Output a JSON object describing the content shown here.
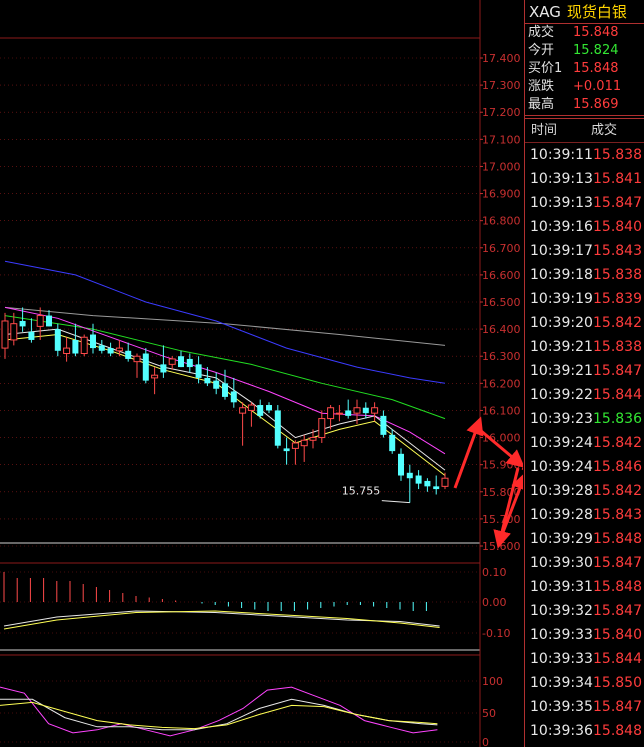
{
  "symbol": {
    "code": "XAG",
    "name": "现货白银"
  },
  "quote": [
    {
      "label": "成交",
      "value": "15.848",
      "color": "#ff3c3c"
    },
    {
      "label": "今开",
      "value": "15.824",
      "color": "#33e633"
    },
    {
      "label": "买价1",
      "value": "15.848",
      "color": "#ff3c3c"
    },
    {
      "label": "涨跌",
      "value": "+0.011",
      "color": "#ff3c3c"
    },
    {
      "label": "最高",
      "value": "15.869",
      "color": "#ff3c3c"
    }
  ],
  "ticks_header": {
    "time": "时间",
    "price": "成交"
  },
  "ticks": [
    {
      "time": "10:39:11",
      "price": "15.838",
      "dir": "up"
    },
    {
      "time": "10:39:13",
      "price": "15.841",
      "dir": "up"
    },
    {
      "time": "10:39:13",
      "price": "15.847",
      "dir": "up"
    },
    {
      "time": "10:39:16",
      "price": "15.840",
      "dir": "up"
    },
    {
      "time": "10:39:17",
      "price": "15.843",
      "dir": "up"
    },
    {
      "time": "10:39:18",
      "price": "15.838",
      "dir": "up"
    },
    {
      "time": "10:39:19",
      "price": "15.839",
      "dir": "up"
    },
    {
      "time": "10:39:20",
      "price": "15.842",
      "dir": "up"
    },
    {
      "time": "10:39:21",
      "price": "15.838",
      "dir": "up"
    },
    {
      "time": "10:39:21",
      "price": "15.847",
      "dir": "up"
    },
    {
      "time": "10:39:22",
      "price": "15.844",
      "dir": "up"
    },
    {
      "time": "10:39:23",
      "price": "15.836",
      "dir": "down"
    },
    {
      "time": "10:39:24",
      "price": "15.842",
      "dir": "up"
    },
    {
      "time": "10:39:24",
      "price": "15.846",
      "dir": "up"
    },
    {
      "time": "10:39:28",
      "price": "15.842",
      "dir": "up"
    },
    {
      "time": "10:39:28",
      "price": "15.843",
      "dir": "up"
    },
    {
      "time": "10:39:29",
      "price": "15.848",
      "dir": "up"
    },
    {
      "time": "10:39:30",
      "price": "15.847",
      "dir": "up"
    },
    {
      "time": "10:39:31",
      "price": "15.848",
      "dir": "up"
    },
    {
      "time": "10:39:32",
      "price": "15.847",
      "dir": "up"
    },
    {
      "time": "10:39:33",
      "price": "15.840",
      "dir": "up"
    },
    {
      "time": "10:39:33",
      "price": "15.844",
      "dir": "up"
    },
    {
      "time": "10:39:34",
      "price": "15.850",
      "dir": "up"
    },
    {
      "time": "10:39:35",
      "price": "15.847",
      "dir": "up"
    },
    {
      "time": "10:39:36",
      "price": "15.848",
      "dir": "up"
    }
  ],
  "colors": {
    "up": "#ff3c3c",
    "down": "#33e633",
    "candle_up": "#ff4a4a",
    "candle_down": "#54ffff",
    "grid": "#8b1a1a",
    "axis_text": "#c83030",
    "ma_white": "#e8e8e8",
    "ma_yellow": "#ffff55",
    "ma_magenta": "#ff44ff",
    "ma_green": "#22dd22",
    "ma_blue": "#3b3bff",
    "ma_gray": "#9a9a9a",
    "arrow": "#ff2a2a"
  },
  "chart_data": [
    {
      "type": "candlestick",
      "y_ticks": [
        "17.400",
        "17.300",
        "17.200",
        "17.100",
        "17.000",
        "16.900",
        "16.800",
        "16.700",
        "16.600",
        "16.500",
        "16.400",
        "16.300",
        "16.200",
        "16.100",
        "16.000",
        "15.900",
        "15.800",
        "15.700",
        "15.600"
      ],
      "ylim": [
        15.6,
        17.4
      ],
      "annotation": "15.755",
      "candles": [
        {
          "o": 16.33,
          "h": 16.46,
          "l": 16.29,
          "c": 16.43
        },
        {
          "o": 16.36,
          "h": 16.46,
          "l": 16.34,
          "c": 16.42
        },
        {
          "o": 16.43,
          "h": 16.48,
          "l": 16.39,
          "c": 16.41
        },
        {
          "o": 16.39,
          "h": 16.44,
          "l": 16.35,
          "c": 16.36
        },
        {
          "o": 16.41,
          "h": 16.48,
          "l": 16.36,
          "c": 16.45
        },
        {
          "o": 16.45,
          "h": 16.47,
          "l": 16.41,
          "c": 16.41
        },
        {
          "o": 16.4,
          "h": 16.42,
          "l": 16.3,
          "c": 16.32
        },
        {
          "o": 16.31,
          "h": 16.37,
          "l": 16.28,
          "c": 16.33
        },
        {
          "o": 16.36,
          "h": 16.42,
          "l": 16.3,
          "c": 16.31
        },
        {
          "o": 16.31,
          "h": 16.38,
          "l": 16.3,
          "c": 16.37
        },
        {
          "o": 16.38,
          "h": 16.42,
          "l": 16.31,
          "c": 16.33
        },
        {
          "o": 16.34,
          "h": 16.36,
          "l": 16.31,
          "c": 16.32
        },
        {
          "o": 16.33,
          "h": 16.35,
          "l": 16.3,
          "c": 16.31
        },
        {
          "o": 16.32,
          "h": 16.36,
          "l": 16.3,
          "c": 16.33
        },
        {
          "o": 16.32,
          "h": 16.35,
          "l": 16.28,
          "c": 16.29
        },
        {
          "o": 16.28,
          "h": 16.31,
          "l": 16.22,
          "c": 16.3
        },
        {
          "o": 16.31,
          "h": 16.33,
          "l": 16.2,
          "c": 16.21
        },
        {
          "o": 16.22,
          "h": 16.26,
          "l": 16.16,
          "c": 16.23
        },
        {
          "o": 16.27,
          "h": 16.34,
          "l": 16.22,
          "c": 16.24
        },
        {
          "o": 16.27,
          "h": 16.3,
          "l": 16.25,
          "c": 16.29
        },
        {
          "o": 16.3,
          "h": 16.32,
          "l": 16.26,
          "c": 16.26
        },
        {
          "o": 16.29,
          "h": 16.31,
          "l": 16.24,
          "c": 16.26
        },
        {
          "o": 16.27,
          "h": 16.3,
          "l": 16.2,
          "c": 16.22
        },
        {
          "o": 16.22,
          "h": 16.26,
          "l": 16.19,
          "c": 16.2
        },
        {
          "o": 16.21,
          "h": 16.24,
          "l": 16.16,
          "c": 16.18
        },
        {
          "o": 16.2,
          "h": 16.25,
          "l": 16.14,
          "c": 16.15
        },
        {
          "o": 16.17,
          "h": 16.22,
          "l": 16.11,
          "c": 16.13
        },
        {
          "o": 16.09,
          "h": 16.13,
          "l": 15.97,
          "c": 16.11
        },
        {
          "o": 16.1,
          "h": 16.13,
          "l": 16.04,
          "c": 16.12
        },
        {
          "o": 16.12,
          "h": 16.14,
          "l": 16.07,
          "c": 16.08
        },
        {
          "o": 16.12,
          "h": 16.13,
          "l": 16.09,
          "c": 16.1
        },
        {
          "o": 16.1,
          "h": 16.12,
          "l": 15.96,
          "c": 15.97
        },
        {
          "o": 15.96,
          "h": 16.0,
          "l": 15.9,
          "c": 15.95
        },
        {
          "o": 15.96,
          "h": 15.99,
          "l": 15.9,
          "c": 15.98
        },
        {
          "o": 15.97,
          "h": 16.01,
          "l": 15.91,
          "c": 15.99
        },
        {
          "o": 15.99,
          "h": 16.03,
          "l": 15.96,
          "c": 16.0
        },
        {
          "o": 16.0,
          "h": 16.1,
          "l": 15.98,
          "c": 16.07
        },
        {
          "o": 16.07,
          "h": 16.12,
          "l": 16.03,
          "c": 16.11
        },
        {
          "o": 16.09,
          "h": 16.12,
          "l": 16.06,
          "c": 16.09
        },
        {
          "o": 16.1,
          "h": 16.14,
          "l": 16.07,
          "c": 16.08
        },
        {
          "o": 16.09,
          "h": 16.14,
          "l": 16.05,
          "c": 16.11
        },
        {
          "o": 16.11,
          "h": 16.13,
          "l": 16.07,
          "c": 16.09
        },
        {
          "o": 16.09,
          "h": 16.13,
          "l": 16.06,
          "c": 16.11
        },
        {
          "o": 16.08,
          "h": 16.1,
          "l": 16.0,
          "c": 16.01
        },
        {
          "o": 16.01,
          "h": 16.03,
          "l": 15.94,
          "c": 15.95
        },
        {
          "o": 15.94,
          "h": 15.96,
          "l": 15.84,
          "c": 15.86
        },
        {
          "o": 15.87,
          "h": 15.9,
          "l": 15.76,
          "c": 15.85
        },
        {
          "o": 15.86,
          "h": 15.88,
          "l": 15.81,
          "c": 15.83
        },
        {
          "o": 15.84,
          "h": 15.85,
          "l": 15.8,
          "c": 15.82
        },
        {
          "o": 15.82,
          "h": 15.86,
          "l": 15.79,
          "c": 15.81
        },
        {
          "o": 15.82,
          "h": 15.87,
          "l": 15.81,
          "c": 15.85
        }
      ],
      "moving_averages": [
        {
          "color": "ma_gray",
          "points": [
            [
              0,
              16.48
            ],
            [
              10,
              16.45
            ],
            [
              25,
              16.42
            ],
            [
              38,
              16.38
            ],
            [
              50,
              16.34
            ]
          ]
        },
        {
          "color": "ma_blue",
          "points": [
            [
              0,
              16.65
            ],
            [
              8,
              16.6
            ],
            [
              16,
              16.5
            ],
            [
              24,
              16.43
            ],
            [
              32,
              16.33
            ],
            [
              40,
              16.26
            ],
            [
              46,
              16.22
            ],
            [
              50,
              16.2
            ]
          ]
        },
        {
          "color": "ma_green",
          "points": [
            [
              0,
              16.45
            ],
            [
              10,
              16.4
            ],
            [
              20,
              16.32
            ],
            [
              28,
              16.27
            ],
            [
              36,
              16.2
            ],
            [
              44,
              16.14
            ],
            [
              50,
              16.07
            ]
          ]
        },
        {
          "color": "ma_magenta",
          "points": [
            [
              0,
              16.48
            ],
            [
              6,
              16.44
            ],
            [
              12,
              16.37
            ],
            [
              18,
              16.3
            ],
            [
              24,
              16.24
            ],
            [
              30,
              16.17
            ],
            [
              36,
              16.09
            ],
            [
              42,
              16.08
            ],
            [
              46,
              16.02
            ],
            [
              50,
              15.94
            ]
          ]
        },
        {
          "color": "ma_white",
          "points": [
            [
              0,
              16.38
            ],
            [
              6,
              16.4
            ],
            [
              12,
              16.33
            ],
            [
              18,
              16.26
            ],
            [
              24,
              16.22
            ],
            [
              28,
              16.13
            ],
            [
              33,
              16.0
            ],
            [
              38,
              16.05
            ],
            [
              42,
              16.08
            ],
            [
              46,
              15.98
            ],
            [
              50,
              15.88
            ]
          ]
        },
        {
          "color": "ma_yellow",
          "points": [
            [
              0,
              16.36
            ],
            [
              6,
              16.38
            ],
            [
              12,
              16.32
            ],
            [
              18,
              16.25
            ],
            [
              24,
              16.2
            ],
            [
              28,
              16.1
            ],
            [
              33,
              15.98
            ],
            [
              38,
              16.03
            ],
            [
              42,
              16.06
            ],
            [
              46,
              15.96
            ],
            [
              50,
              15.86
            ]
          ]
        }
      ]
    },
    {
      "type": "bar",
      "y_ticks": [
        "0.10",
        "0.00",
        "-0.10"
      ],
      "ylim": [
        -0.1,
        0.1
      ],
      "histogram": [
        0.1,
        0.08,
        0.08,
        0.08,
        0.07,
        0.07,
        0.06,
        0.05,
        0.04,
        0.03,
        0.02,
        0.015,
        0.01,
        0.005,
        0.0,
        -0.005,
        -0.01,
        -0.015,
        -0.02,
        -0.025,
        -0.03,
        -0.03,
        -0.03,
        -0.025,
        -0.02,
        -0.015,
        -0.01,
        -0.01,
        -0.015,
        -0.02,
        -0.025,
        -0.03,
        -0.03
      ],
      "lines": [
        {
          "color": "ma_white",
          "points": [
            [
              0,
              -0.08
            ],
            [
              4,
              -0.05
            ],
            [
              10,
              -0.03
            ],
            [
              16,
              -0.035
            ],
            [
              22,
              -0.05
            ],
            [
              26,
              -0.06
            ],
            [
              30,
              -0.065
            ],
            [
              33,
              -0.08
            ]
          ]
        },
        {
          "color": "ma_yellow",
          "points": [
            [
              0,
              -0.09
            ],
            [
              4,
              -0.06
            ],
            [
              10,
              -0.035
            ],
            [
              16,
              -0.03
            ],
            [
              22,
              -0.045
            ],
            [
              26,
              -0.055
            ],
            [
              30,
              -0.07
            ],
            [
              33,
              -0.085
            ]
          ]
        }
      ]
    },
    {
      "type": "line",
      "y_ticks": [
        "100",
        "50",
        "0"
      ],
      "ylim": [
        0,
        100
      ],
      "lines": [
        {
          "color": "ma_magenta",
          "points": [
            [
              0,
              90
            ],
            [
              3,
              80
            ],
            [
              6,
              30
            ],
            [
              9,
              15
            ],
            [
              12,
              20
            ],
            [
              15,
              30
            ],
            [
              18,
              20
            ],
            [
              21,
              10
            ],
            [
              24,
              20
            ],
            [
              27,
              35
            ],
            [
              30,
              55
            ],
            [
              33,
              85
            ],
            [
              36,
              90
            ],
            [
              39,
              75
            ],
            [
              42,
              60
            ],
            [
              45,
              35
            ],
            [
              48,
              25
            ],
            [
              51,
              15
            ],
            [
              54,
              20
            ]
          ]
        },
        {
          "color": "ma_white",
          "points": [
            [
              0,
              70
            ],
            [
              4,
              70
            ],
            [
              8,
              40
            ],
            [
              12,
              25
            ],
            [
              16,
              25
            ],
            [
              20,
              20
            ],
            [
              24,
              20
            ],
            [
              28,
              30
            ],
            [
              32,
              55
            ],
            [
              36,
              70
            ],
            [
              40,
              60
            ],
            [
              44,
              45
            ],
            [
              48,
              35
            ],
            [
              52,
              30
            ],
            [
              54,
              28
            ]
          ]
        },
        {
          "color": "ma_yellow",
          "points": [
            [
              0,
              60
            ],
            [
              4,
              65
            ],
            [
              8,
              50
            ],
            [
              12,
              35
            ],
            [
              16,
              28
            ],
            [
              20,
              24
            ],
            [
              24,
              22
            ],
            [
              28,
              28
            ],
            [
              32,
              45
            ],
            [
              36,
              60
            ],
            [
              40,
              58
            ],
            [
              44,
              45
            ],
            [
              48,
              35
            ],
            [
              52,
              32
            ],
            [
              54,
              30
            ]
          ]
        }
      ]
    }
  ]
}
